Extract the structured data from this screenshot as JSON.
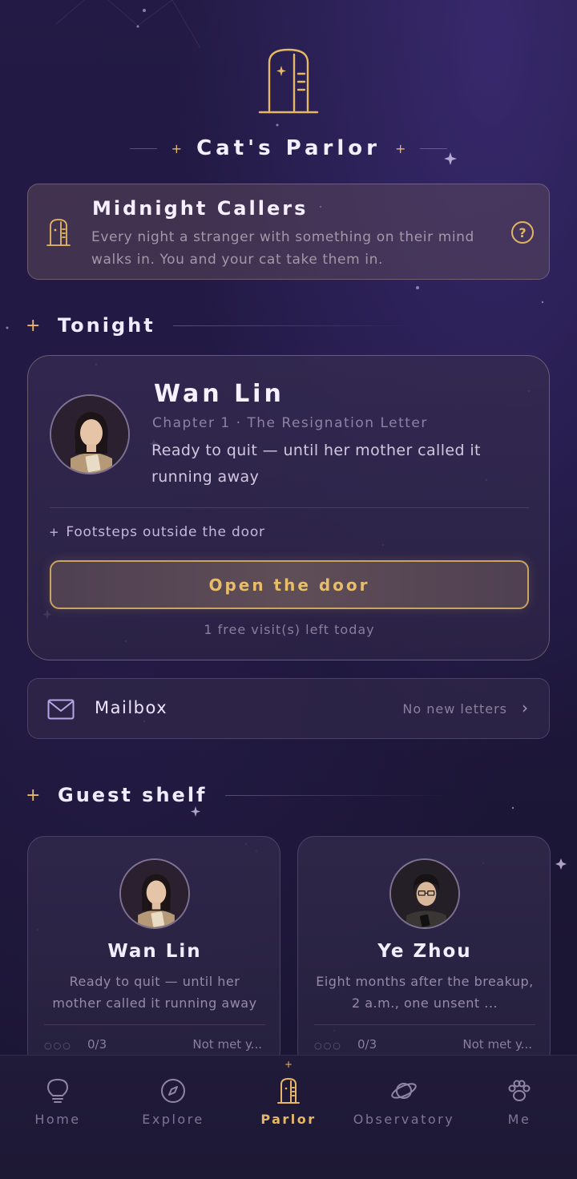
{
  "app": {
    "title": "Cat's Parlor"
  },
  "banner": {
    "title": "Midnight Callers",
    "description": "Every night a stranger with something on their mind walks in. You and your cat take them in.",
    "help_icon": "question-mark-circle",
    "help_glyph": "?"
  },
  "tonight": {
    "section_title": "Tonight",
    "guest": {
      "name": "Wan Lin",
      "chapter": "Chapter 1 · The Resignation Letter",
      "description": "Ready to quit — until her mother called it running away"
    },
    "status": "Footsteps outside the door",
    "action_label": "Open the door",
    "free_visits": "1 free visit(s) left today"
  },
  "mailbox": {
    "label": "Mailbox",
    "status": "No new letters",
    "chevron": "›"
  },
  "guest_shelf": {
    "section_title": "Guest shelf",
    "guests": [
      {
        "name": "Wan Lin",
        "description": "Ready to quit — until her mother called it running away",
        "progress_dots": "○○○",
        "progress": "0/3",
        "status": "Not met y..."
      },
      {
        "name": "Ye Zhou",
        "description": "Eight months after the breakup, 2 a.m., one unsent ...",
        "progress_dots": "○○○",
        "progress": "0/3",
        "status": "Not met y..."
      }
    ]
  },
  "nav": {
    "items": [
      {
        "label": "Home",
        "icon": "lightbulb-icon"
      },
      {
        "label": "Explore",
        "icon": "compass-icon"
      },
      {
        "label": "Parlor",
        "icon": "door-icon",
        "active": true
      },
      {
        "label": "Observatory",
        "icon": "planet-icon"
      },
      {
        "label": "Me",
        "icon": "paw-icon"
      }
    ],
    "active_indicator": "+"
  },
  "decor": {
    "spark": "+",
    "sparkle": "✦"
  },
  "colors": {
    "accent_gold": "#e6b865",
    "background": "#1c1734",
    "card": "#2e2648"
  }
}
